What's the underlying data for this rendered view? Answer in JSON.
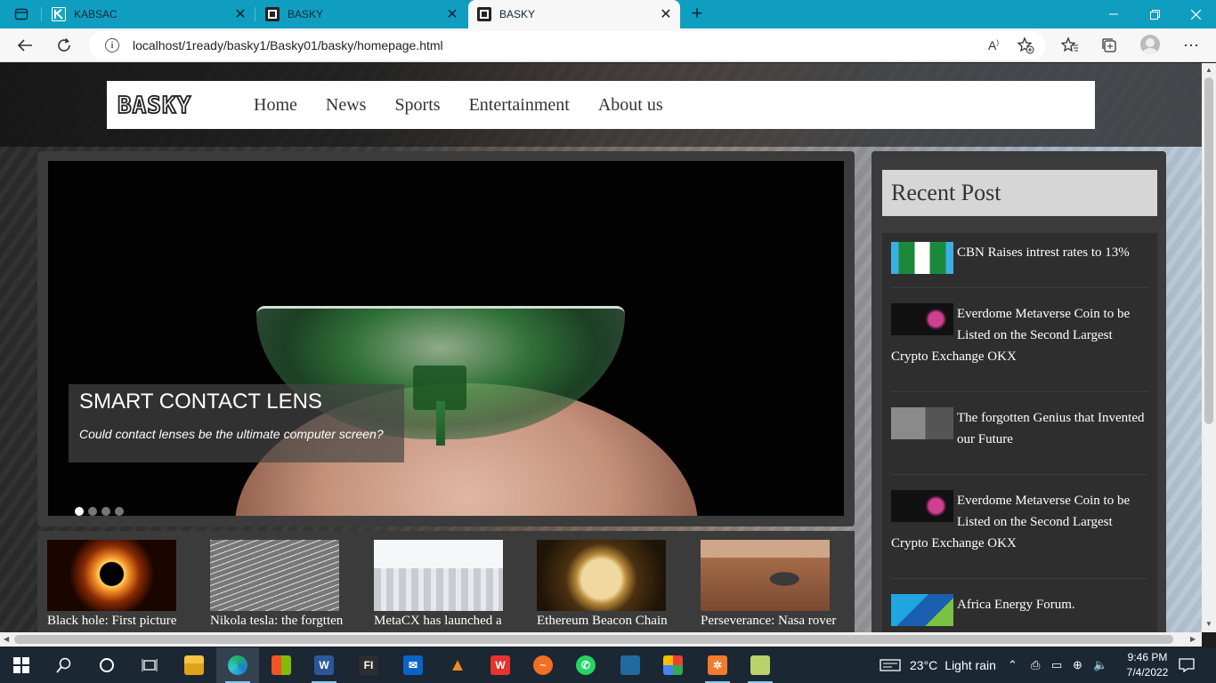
{
  "browser": {
    "tabs": [
      {
        "title": "KABSAC",
        "favicon": "kabsac-favicon"
      },
      {
        "title": "BASKY",
        "favicon": "basky-favicon"
      },
      {
        "title": "BASKY",
        "favicon": "basky-favicon",
        "active": true
      }
    ],
    "url": "localhost/1ready/basky1/Basky01/basky/homepage.html"
  },
  "site": {
    "logo_text": "BASKY",
    "nav": [
      "Home",
      "News",
      "Sports",
      "Entertainment",
      "About us"
    ],
    "slider": {
      "title": "SMART CONTACT LENS",
      "subtitle": "Could contact lenses be the ultimate computer screen?",
      "slide_count": 4,
      "active_slide": 1
    },
    "thumbnails": [
      {
        "label": "Black hole: First picture",
        "image": "black-hole-image"
      },
      {
        "label": "Nikola tesla: the forgtten",
        "image": "nikola-tesla-image"
      },
      {
        "label": "MetaCX has launched a",
        "image": "metacx-image"
      },
      {
        "label": "Ethereum Beacon Chain",
        "image": "ethereum-coin-image"
      },
      {
        "label": "Perseverance: Nasa rover",
        "image": "mars-rover-image"
      }
    ],
    "sidebar": {
      "title": "Recent Post",
      "posts": [
        {
          "text": "CBN Raises intrest rates to 13%",
          "image": "nigeria-flag-image"
        },
        {
          "text": "Everdome Metaverse Coin to be Listed on the Second Largest Crypto Exchange OKX",
          "image": "listing-soon-image"
        },
        {
          "text": "The forgotten Genius that Invented our Future",
          "image": "tesla-portrait-image"
        },
        {
          "text": "Everdome Metaverse Coin to be Listed on the Second Largest Crypto Exchange OKX",
          "image": "listing-soon-image"
        },
        {
          "text": "Africa Energy Forum.",
          "image": "energy-forum-image"
        }
      ]
    }
  },
  "taskbar": {
    "weather_temp": "23°C",
    "weather_desc": "Light rain",
    "time": "9:46 PM",
    "date": "7/4/2022"
  },
  "colors": {
    "tab_strip": "#0f9ec0",
    "taskbar": "#1b2733",
    "panel": "#3b3b3b",
    "sidebar_title_bg": "#d6d6d6"
  }
}
